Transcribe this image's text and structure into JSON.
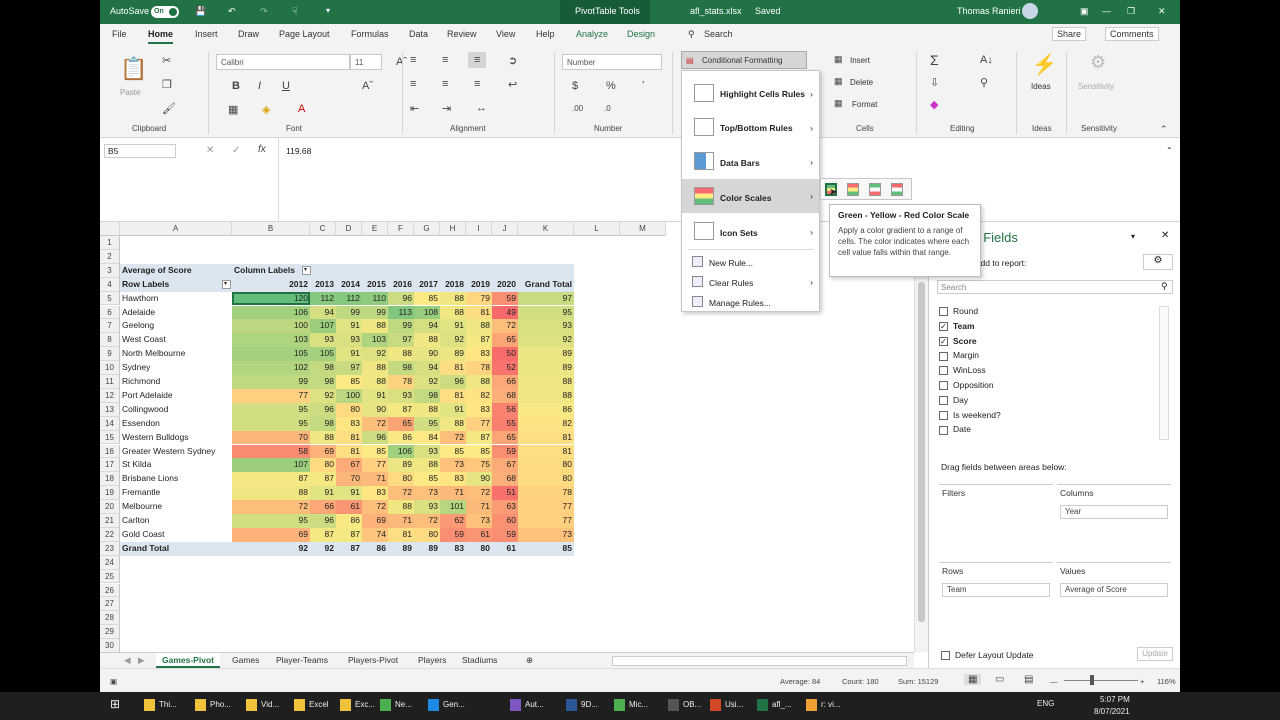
{
  "title_bar": {
    "autosave_label": "AutoSave",
    "autosave_state": "On",
    "context_tab": "PivotTable Tools",
    "filename": "afl_stats.xlsx",
    "saved": "Saved",
    "user": "Thomas Ranieri"
  },
  "tabs": [
    "File",
    "Home",
    "Insert",
    "Draw",
    "Page Layout",
    "Formulas",
    "Data",
    "Review",
    "View",
    "Help",
    "Analyze",
    "Design"
  ],
  "active_tab": "Home",
  "search_label": "Search",
  "share_label": "Share",
  "comments_label": "Comments",
  "ribbon": {
    "paste": "Paste",
    "clipboard": "Clipboard",
    "font_name": "Calibri",
    "font_size": "11",
    "font_group": "Font",
    "alignment_group": "Alignment",
    "number_format": "Number",
    "number_group": "Number",
    "conditional_formatting": "Conditional Formatting",
    "insert": "Insert",
    "delete": "Delete",
    "format": "Format",
    "cells_group": "Cells",
    "editing_group": "Editing",
    "ideas": "Ideas",
    "ideas_group": "Ideas",
    "sensitivity": "Sensitivity",
    "sensitivity_group": "Sensitivity"
  },
  "formula_bar": {
    "name_box": "B5",
    "value": "119.68"
  },
  "columns": [
    "A",
    "B",
    "C",
    "D",
    "E",
    "F",
    "G",
    "H",
    "I",
    "J",
    "K",
    "L",
    "M"
  ],
  "pivot": {
    "title": "Average of Score",
    "col_labels": "Column Labels",
    "row_labels": "Row Labels",
    "years": [
      "2012",
      "2013",
      "2014",
      "2015",
      "2016",
      "2017",
      "2018",
      "2019",
      "2020"
    ],
    "grand_total": "Grand Total",
    "rows": [
      {
        "team": "Hawthorn",
        "v": [
          120,
          112,
          112,
          110,
          96,
          85,
          88,
          79,
          59
        ],
        "gt": 97
      },
      {
        "team": "Adelaide",
        "v": [
          106,
          94,
          99,
          99,
          113,
          108,
          88,
          81,
          49
        ],
        "gt": 95
      },
      {
        "team": "Geelong",
        "v": [
          100,
          107,
          91,
          88,
          99,
          94,
          91,
          88,
          72
        ],
        "gt": 93
      },
      {
        "team": "West Coast",
        "v": [
          103,
          93,
          93,
          103,
          97,
          88,
          92,
          87,
          65
        ],
        "gt": 92
      },
      {
        "team": "North Melbourne",
        "v": [
          105,
          105,
          91,
          92,
          88,
          90,
          89,
          83,
          50
        ],
        "gt": 89
      },
      {
        "team": "Sydney",
        "v": [
          102,
          98,
          97,
          88,
          98,
          94,
          81,
          78,
          52
        ],
        "gt": 89
      },
      {
        "team": "Richmond",
        "v": [
          99,
          98,
          85,
          88,
          78,
          92,
          96,
          88,
          66
        ],
        "gt": 88
      },
      {
        "team": "Port Adelaide",
        "v": [
          77,
          92,
          100,
          91,
          93,
          98,
          81,
          82,
          68
        ],
        "gt": 88
      },
      {
        "team": "Collingwood",
        "v": [
          95,
          96,
          80,
          90,
          87,
          88,
          91,
          83,
          56
        ],
        "gt": 86
      },
      {
        "team": "Essendon",
        "v": [
          95,
          98,
          83,
          72,
          65,
          95,
          88,
          77,
          55
        ],
        "gt": 82
      },
      {
        "team": "Western Bulldogs",
        "v": [
          70,
          88,
          81,
          96,
          86,
          84,
          72,
          87,
          65
        ],
        "gt": 81
      },
      {
        "team": "Greater Western Sydney",
        "v": [
          58,
          69,
          81,
          85,
          106,
          93,
          85,
          85,
          59
        ],
        "gt": 81
      },
      {
        "team": "St Kilda",
        "v": [
          107,
          80,
          67,
          77,
          89,
          88,
          73,
          75,
          67
        ],
        "gt": 80
      },
      {
        "team": "Brisbane Lions",
        "v": [
          87,
          87,
          70,
          71,
          80,
          85,
          83,
          90,
          68
        ],
        "gt": 80
      },
      {
        "team": "Fremantle",
        "v": [
          88,
          91,
          91,
          83,
          72,
          73,
          71,
          72,
          51
        ],
        "gt": 78
      },
      {
        "team": "Melbourne",
        "v": [
          72,
          66,
          61,
          72,
          88,
          93,
          101,
          71,
          63
        ],
        "gt": 77
      },
      {
        "team": "Carlton",
        "v": [
          95,
          96,
          86,
          69,
          71,
          72,
          62,
          73,
          60
        ],
        "gt": 77
      },
      {
        "team": "Gold Coast",
        "v": [
          69,
          87,
          87,
          74,
          81,
          80,
          59,
          61,
          59
        ],
        "gt": 73
      }
    ],
    "total_row": {
      "label": "Grand Total",
      "v": [
        92,
        92,
        87,
        86,
        89,
        89,
        83,
        80,
        61
      ],
      "gt": 85
    }
  },
  "row_numbers": [
    "1",
    "2",
    "3",
    "4",
    "5",
    "6",
    "7",
    "8",
    "9",
    "10",
    "11",
    "12",
    "13",
    "14",
    "15",
    "16",
    "17",
    "18",
    "19",
    "20",
    "21",
    "22",
    "23",
    "24",
    "25",
    "26",
    "27",
    "28",
    "29",
    "30"
  ],
  "sheet_tabs": [
    "Games-Pivot",
    "Games",
    "Player-Teams",
    "Players-Pivot",
    "Players",
    "Stadiums"
  ],
  "active_sheet": "Games-Pivot",
  "status": {
    "average": "Average: 84",
    "count": "Count: 180",
    "sum": "Sum: 15129",
    "zoom": "116%"
  },
  "cf_menu": {
    "items": [
      "Highlight Cells Rules",
      "Top/Bottom Rules",
      "Data Bars",
      "Color Scales",
      "Icon Sets"
    ],
    "small": [
      "New Rule...",
      "Clear Rules",
      "Manage Rules..."
    ],
    "selected": "Color Scales"
  },
  "tooltip": {
    "title": "Green - Yellow - Red Color Scale",
    "body": "Apply a color gradient to a range of cells. The color indicates where each cell value falls within that range."
  },
  "pane": {
    "title": "able Fields",
    "subtitle": "ds to add to report:",
    "search_placeholder": "Search",
    "fields": [
      {
        "name": "Round",
        "checked": false
      },
      {
        "name": "Team",
        "checked": true
      },
      {
        "name": "Score",
        "checked": true
      },
      {
        "name": "Margin",
        "checked": false
      },
      {
        "name": "WinLoss",
        "checked": false
      },
      {
        "name": "Opposition",
        "checked": false
      },
      {
        "name": "Day",
        "checked": false
      },
      {
        "name": "Is weekend?",
        "checked": false
      },
      {
        "name": "Date",
        "checked": false
      }
    ],
    "drag_label": "Drag fields between areas below:",
    "filters": "Filters",
    "columns": "Columns",
    "columns_value": "Year",
    "rows": "Rows",
    "rows_value": "Team",
    "values": "Values",
    "values_value": "Average of Score",
    "defer": "Defer Layout Update",
    "update": "Update"
  },
  "taskbar": {
    "items": [
      "Thi...",
      "Pho...",
      "Vid...",
      "Excel",
      "Exc...",
      "Ne...",
      "Gen...",
      "Aut...",
      "9D...",
      "Mic...",
      "OB...",
      "Usi...",
      "afl_...",
      "r: vi..."
    ],
    "lang": "ENG",
    "time": "5:07 PM",
    "date": "8/07/2021"
  }
}
